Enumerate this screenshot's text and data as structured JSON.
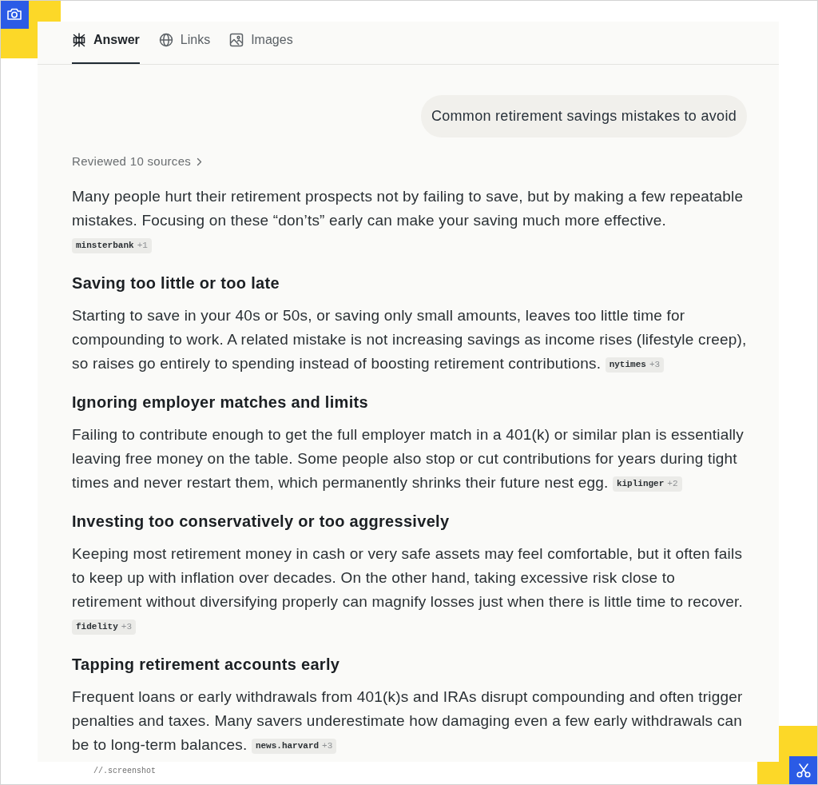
{
  "tabs": [
    {
      "label": "Answer",
      "selected": true
    },
    {
      "label": "Links",
      "selected": false
    },
    {
      "label": "Images",
      "selected": false
    }
  ],
  "query": {
    "text": "Common retirement savings mistakes to avoid"
  },
  "sources_link": {
    "label": "Reviewed 10 sources"
  },
  "answer": {
    "intro": {
      "text": "Many people hurt their retirement prospects not by failing to save, but by making a few repeatable mistakes. Focusing on these “don’ts” early can make your saving much more effective.",
      "citation": {
        "source": "minsterbank",
        "more": "+1"
      }
    },
    "sections": [
      {
        "heading": "Saving too little or too late",
        "text": "Starting to save in your 40s or 50s, or saving only small amounts, leaves too little time for compounding to work. A related mistake is not increasing savings as income rises (lifestyle creep), so raises go entirely to spending instead of boosting retirement contributions.",
        "citation": {
          "source": "nytimes",
          "more": "+3"
        }
      },
      {
        "heading": "Ignoring employer matches and limits",
        "text": "Failing to contribute enough to get the full employer match in a 401(k) or similar plan is essentially leaving free money on the table. Some people also stop or cut contributions for years during tight times and never restart them, which permanently shrinks their future nest egg.",
        "citation": {
          "source": "kiplinger",
          "more": "+2"
        }
      },
      {
        "heading": "Investing too conservatively or too aggressively",
        "text": "Keeping most retirement money in cash or very safe assets may feel comfortable, but it often fails to keep up with inflation over decades. On the other hand, taking excessive risk close to retirement without diversifying properly can magnify losses just when there is little time to recover.",
        "citation": {
          "source": "fidelity",
          "more": "+3"
        }
      },
      {
        "heading": "Tapping retirement accounts early",
        "text": "Frequent loans or early withdrawals from 401(k)s and IRAs disrupt compounding and often trigger penalties and taxes. Many savers underestimate how damaging even a few early withdrawals can be to long-term balances.",
        "citation": {
          "source": "news.harvard",
          "more": "+3"
        }
      }
    ]
  },
  "footer": {
    "text": "//.screenshot"
  }
}
